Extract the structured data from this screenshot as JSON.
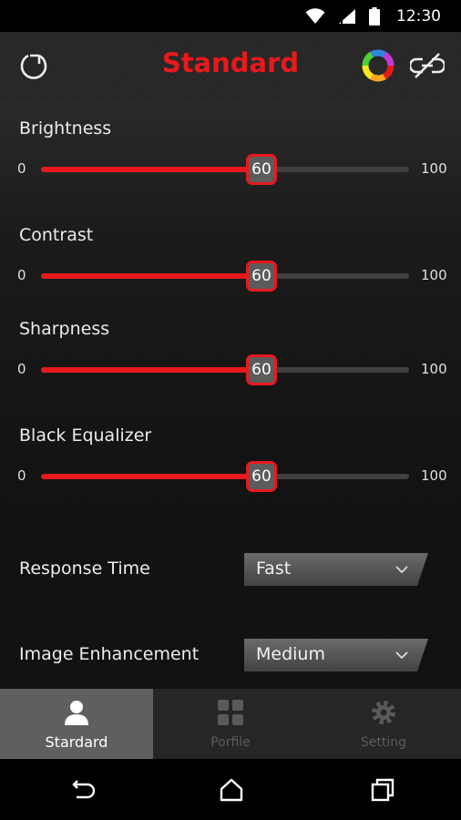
{
  "status_bar": {
    "time": "12:30"
  },
  "header": {
    "title": "Standard",
    "refresh_icon": "refresh-icon",
    "color_icon": "color-wheel-icon",
    "link_icon": "unlink-icon"
  },
  "sliders": [
    {
      "label": "Brightness",
      "min": "0",
      "max": "100",
      "value": "60",
      "fraction": 0.6
    },
    {
      "label": "Contrast",
      "min": "0",
      "max": "100",
      "value": "60",
      "fraction": 0.6
    },
    {
      "label": "Sharpness",
      "min": "0",
      "max": "100",
      "value": "60",
      "fraction": 0.6
    },
    {
      "label": "Black Equalizer",
      "min": "0",
      "max": "100",
      "value": "60",
      "fraction": 0.6
    }
  ],
  "response_time": {
    "label": "Response Time",
    "value": "Fast"
  },
  "image_enhancement": {
    "label": "Image Enhancement",
    "value": "Medium"
  },
  "tabs": [
    {
      "label": "Stardard",
      "icon": "user-icon",
      "active": true
    },
    {
      "label": "Porfile",
      "icon": "grid-icon",
      "active": false
    },
    {
      "label": "Setting",
      "icon": "gear-icon",
      "active": false
    }
  ],
  "colors": {
    "accent": "#e8191b",
    "thumb": "#5c5c5c",
    "track": "#404040"
  }
}
